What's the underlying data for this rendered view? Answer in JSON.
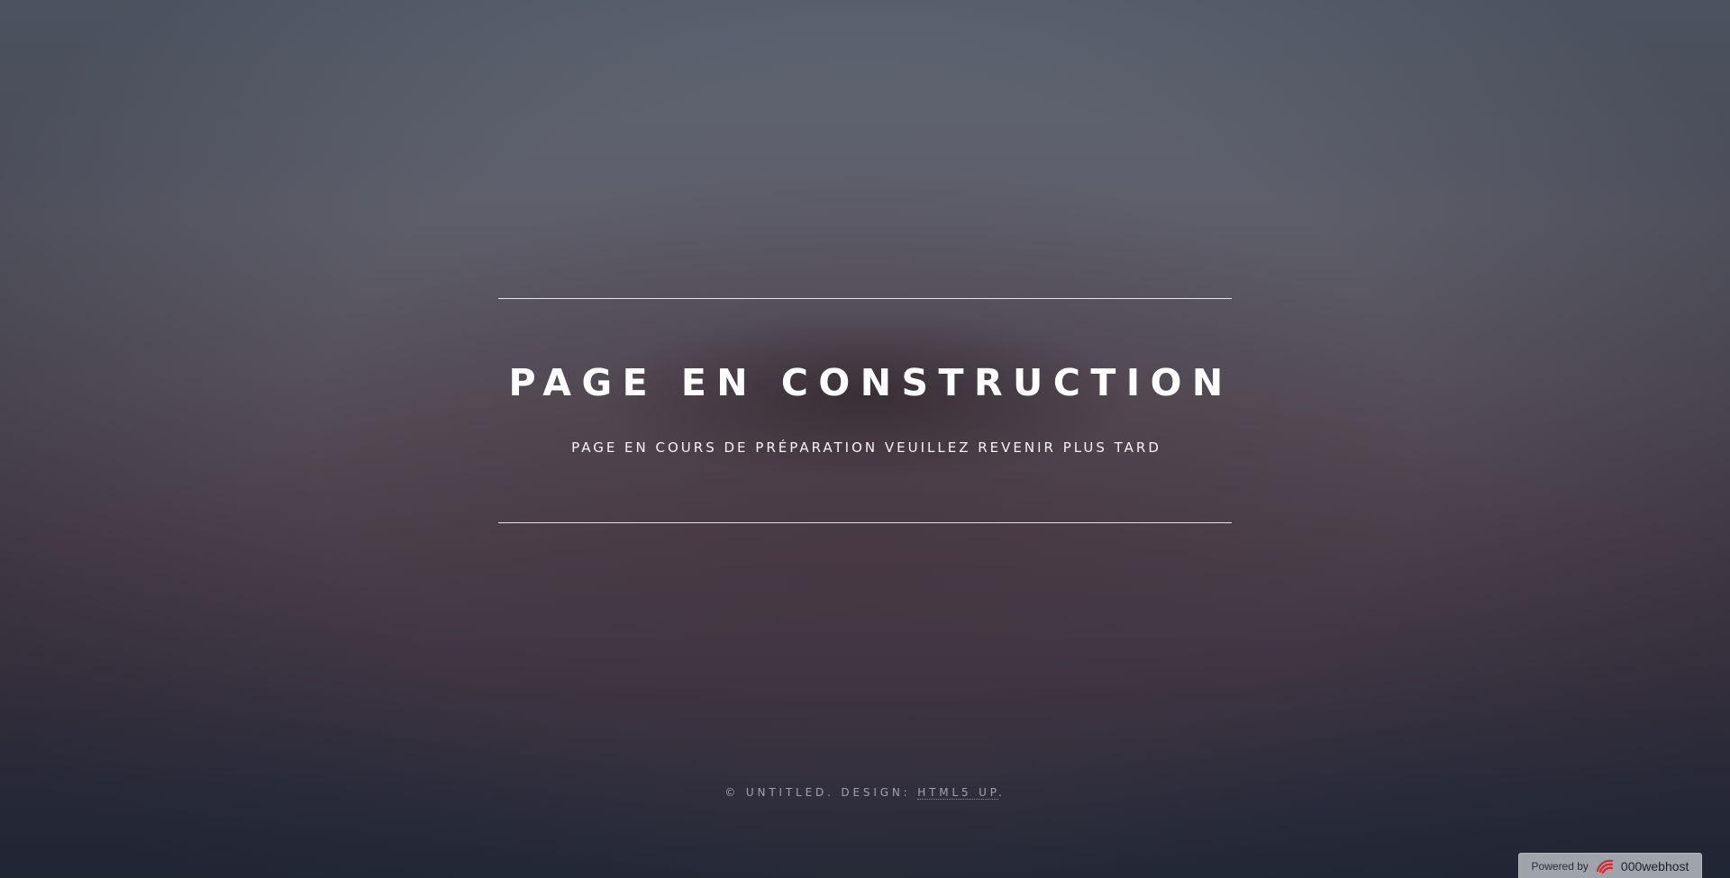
{
  "header": {
    "title": "PAGE EN CONSTRUCTION",
    "subtitle": "PAGE EN COURS DE PRÉPARATION VEUILLEZ REVENIR PLUS TARD"
  },
  "footer": {
    "copyright_prefix": "© UNTITLED. DESIGN: ",
    "design_link": "HTML5 UP",
    "suffix": "."
  },
  "badge": {
    "powered_label": "Powered by",
    "brand_icon": "000webhost-logo-icon",
    "brand_name": "000webhost"
  },
  "colors": {
    "text": "#ffffff",
    "bg_top": "#5e6572",
    "bg_bottom": "#252a38",
    "badge_bg": "#9fa3aa",
    "brand_red": "#e0232c"
  }
}
